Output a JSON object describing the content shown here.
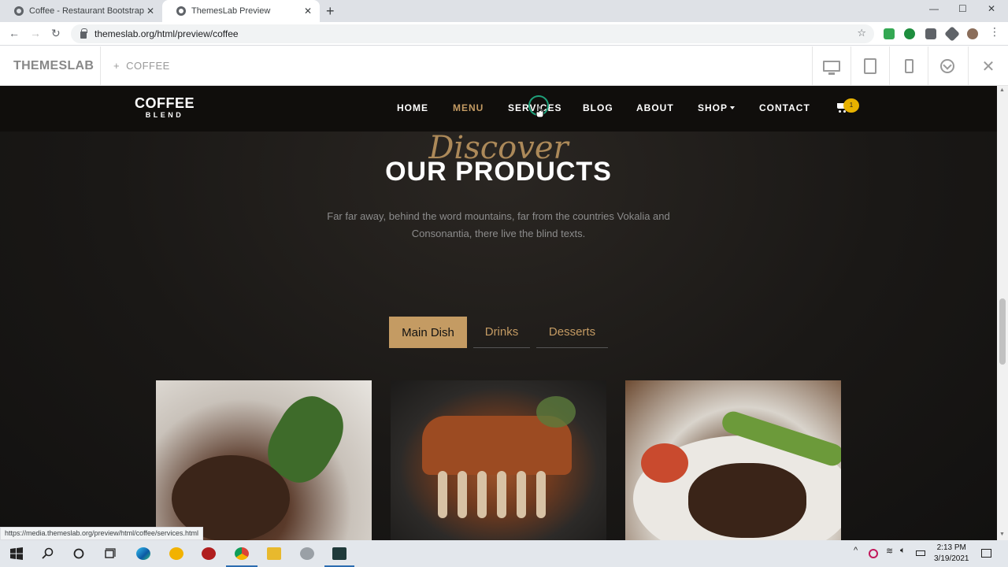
{
  "browser": {
    "tabs": [
      {
        "title": "Coffee - Restaurant Bootstrap HT",
        "active": false
      },
      {
        "title": "ThemesLab Preview",
        "active": true
      }
    ],
    "url": "themeslab.org/html/preview/coffee",
    "status_url": "https://media.themeslab.org/preview/html/coffee/services.html"
  },
  "preview_bar": {
    "brand": "THEMESLAB",
    "theme_name": "COFFEE",
    "plus": "+",
    "device_buttons": [
      "desktop-icon",
      "tablet-icon",
      "phone-icon",
      "download-icon",
      "close-icon"
    ]
  },
  "site": {
    "logo_line1": "COFFEE",
    "logo_line2": "BLEND",
    "nav": [
      {
        "label": "HOME",
        "active": false
      },
      {
        "label": "MENU",
        "active": true
      },
      {
        "label": "SERVICES",
        "active": false
      },
      {
        "label": "BLOG",
        "active": false
      },
      {
        "label": "ABOUT",
        "active": false
      },
      {
        "label": "SHOP",
        "active": false,
        "dropdown": true
      },
      {
        "label": "CONTACT",
        "active": false
      }
    ],
    "cart_count": "1",
    "section": {
      "script_title": "Discover",
      "title": "OUR PRODUCTS",
      "intro_line1": "Far far away, behind the word mountains, far from the countries Vokalia and",
      "intro_line2": "Consonantia, there live the blind texts."
    },
    "product_tabs": [
      {
        "label": "Main Dish",
        "active": true
      },
      {
        "label": "Drinks",
        "active": false
      },
      {
        "label": "Desserts",
        "active": false
      }
    ],
    "accent_color": "#c49b63"
  },
  "taskbar": {
    "time": "2:13 PM",
    "date": "3/19/2021"
  }
}
